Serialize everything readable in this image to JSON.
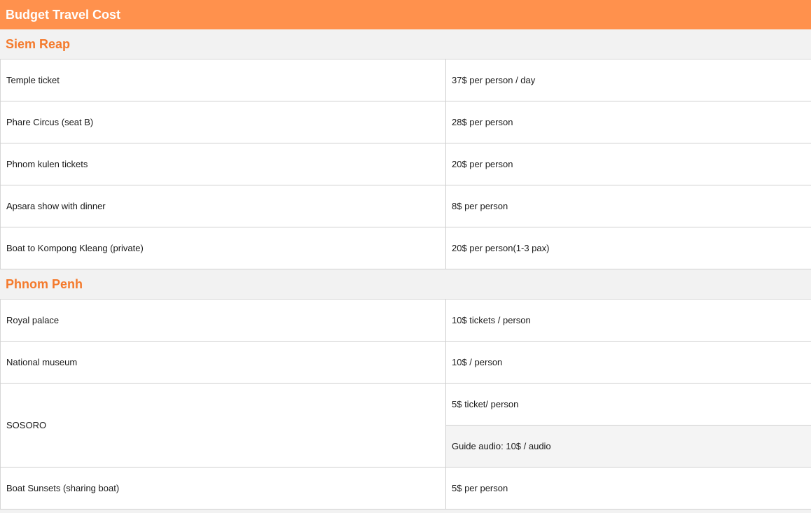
{
  "title": "Budget Travel Cost",
  "sections": [
    {
      "name": "Siem Reap",
      "rows": [
        {
          "item": "Temple ticket",
          "cost": "37$ per person / day"
        },
        {
          "item": "Phare Circus (seat B)",
          "cost": "28$ per person"
        },
        {
          "item": "Phnom kulen tickets",
          "cost": "20$ per person"
        },
        {
          "item": "Apsara show with dinner",
          "cost": "8$ per person"
        },
        {
          "item": "Boat to Kompong Kleang (private)",
          "cost": "20$ per person(1-3 pax)"
        }
      ]
    },
    {
      "name": "Phnom Penh",
      "rows": [
        {
          "item": "Royal palace",
          "cost": "10$ tickets / person"
        },
        {
          "item": "National museum",
          "cost": "10$ / person"
        },
        {
          "item": "SOSORO",
          "cost": "5$ ticket/ person",
          "extra_cost": "Guide audio: 10$ / audio"
        },
        {
          "item": "Boat Sunsets (sharing boat)",
          "cost": "5$ per person"
        }
      ]
    }
  ]
}
